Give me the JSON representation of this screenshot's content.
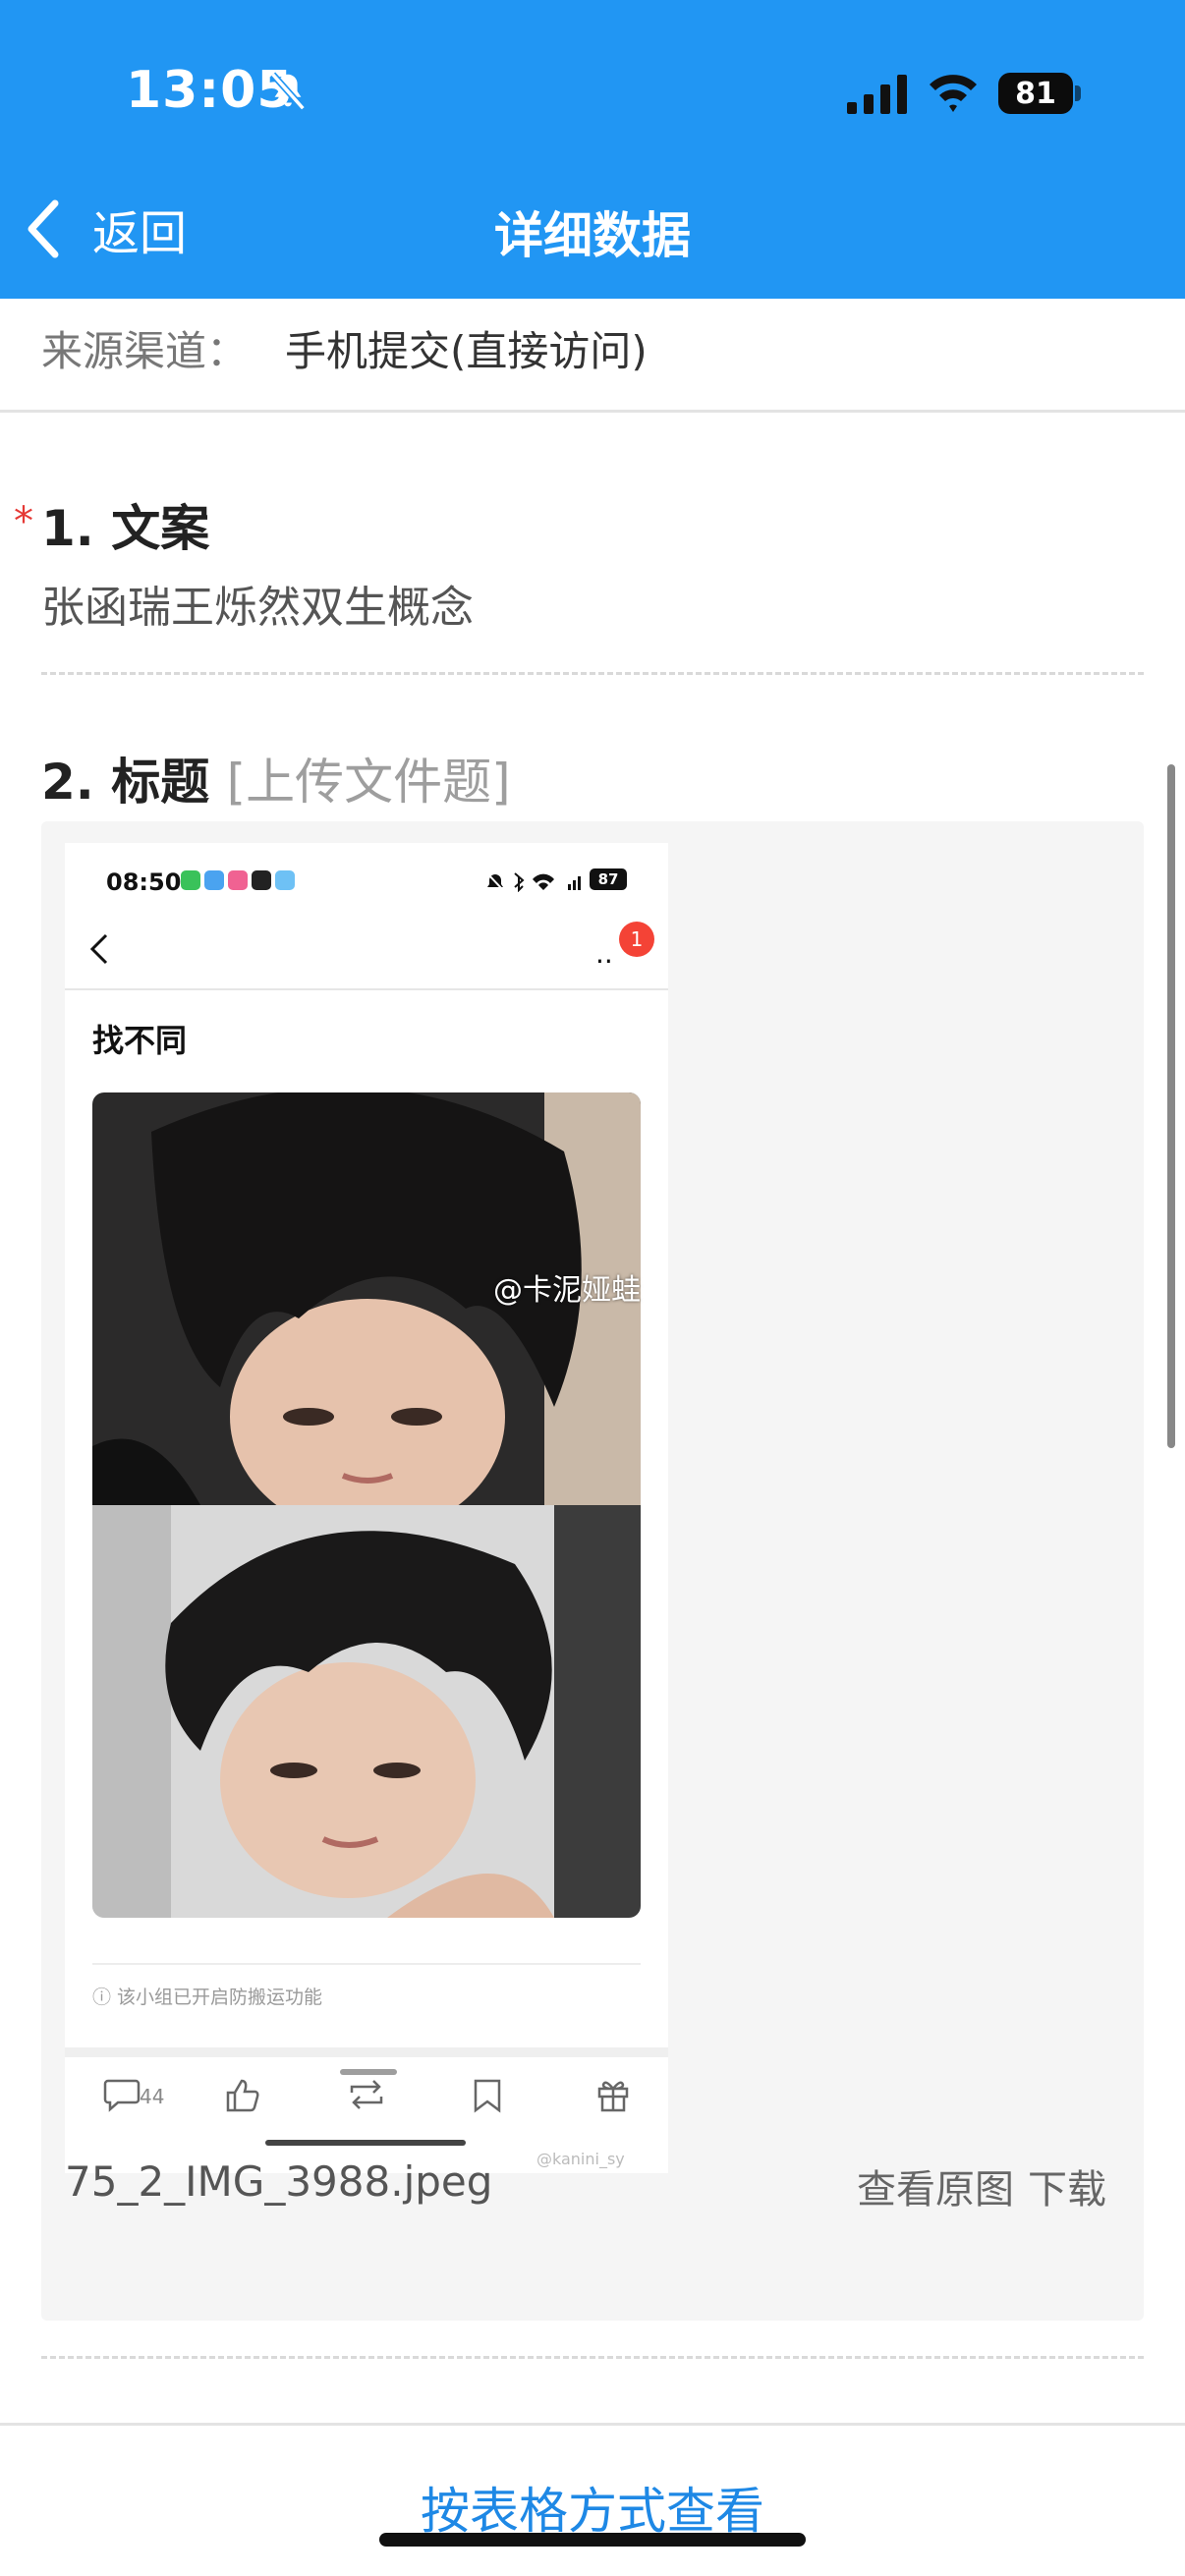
{
  "status_bar": {
    "time": "13:05",
    "battery": "81"
  },
  "nav": {
    "back_label": "返回",
    "title": "详细数据"
  },
  "source": {
    "label": "来源渠道：",
    "value": "手机提交(直接访问)"
  },
  "fields": [
    {
      "number_title": "1. 文案",
      "required": true,
      "answer": "张函瑞王烁然双生概念"
    },
    {
      "number_title": "2. 标题",
      "hint": "[上传文件题]"
    }
  ],
  "attachment": {
    "file_name": "75_2_IMG_3988.jpeg",
    "view_original": "查看原图",
    "download": "下载",
    "preview": {
      "time": "08:50",
      "battery": "87",
      "badge": "1",
      "more": "··",
      "title": "找不同",
      "watermark": "@卡泥娅蛙",
      "note": "ⓘ 该小组已开启防搬运功能",
      "comment_count": "44",
      "watermark2": "@kanini_sy"
    }
  },
  "footer": {
    "table_view": "按表格方式查看"
  },
  "colors": {
    "header": "#2196f3",
    "link": "#1e88e5",
    "required": "#e53935"
  }
}
